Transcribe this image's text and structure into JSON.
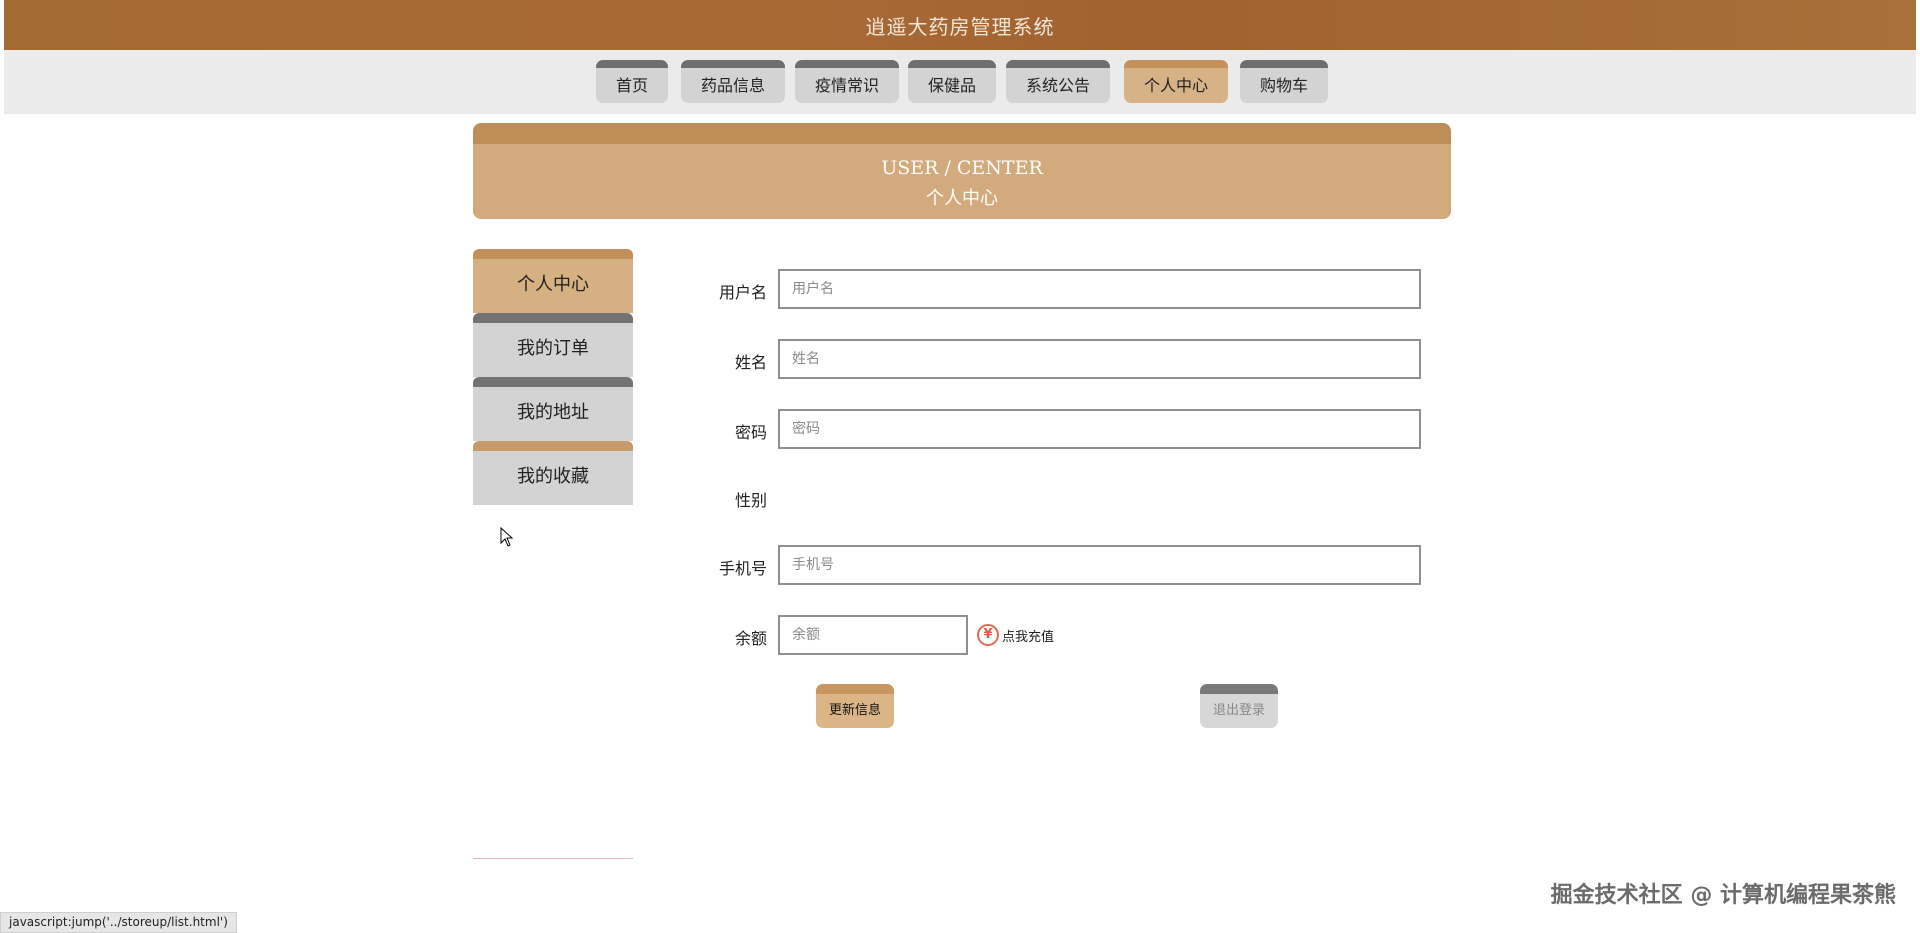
{
  "header": {
    "title": "逍遥大药房管理系统"
  },
  "nav": {
    "items": [
      {
        "label": "首页"
      },
      {
        "label": "药品信息"
      },
      {
        "label": "疫情常识"
      },
      {
        "label": "保健品"
      },
      {
        "label": "系统公告"
      },
      {
        "label": "个人中心",
        "active": true
      },
      {
        "label": "购物车"
      }
    ]
  },
  "banner": {
    "title_en": "USER / CENTER",
    "title_cn": "个人中心"
  },
  "sidebar": {
    "items": [
      {
        "label": "个人中心",
        "active": true
      },
      {
        "label": "我的订单"
      },
      {
        "label": "我的地址"
      },
      {
        "label": "我的收藏"
      }
    ]
  },
  "form": {
    "username": {
      "label": "用户名",
      "placeholder": "用户名",
      "value": ""
    },
    "name": {
      "label": "姓名",
      "placeholder": "姓名",
      "value": ""
    },
    "password": {
      "label": "密码",
      "placeholder": "密码",
      "value": ""
    },
    "gender": {
      "label": "性别"
    },
    "phone": {
      "label": "手机号",
      "placeholder": "手机号",
      "value": ""
    },
    "balance": {
      "label": "余额",
      "placeholder": "余额",
      "value": ""
    },
    "recharge": {
      "icon": "yen-icon",
      "label": "点我充值"
    },
    "update_button": "更新信息",
    "logout_button": "退出登录"
  },
  "status_bar": {
    "text": "javascript:jump('../storeup/list.html')"
  },
  "watermark": "掘金技术社区 @ 计算机编程果茶熊",
  "colors": {
    "header": "#a86a35",
    "accent": "#d5b080",
    "tab_inactive": "#d3d3d3"
  }
}
